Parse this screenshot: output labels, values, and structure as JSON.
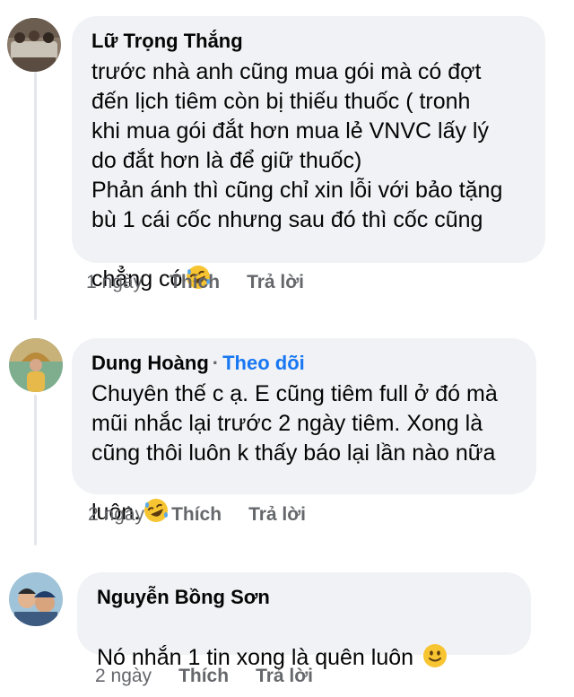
{
  "comments": [
    {
      "author": "Lữ Trọng Thắng",
      "follow": "",
      "text": "trước nhà anh cũng mua gói mà có đợt\nđến lịch tiêm còn bị thiếu thuốc ( tronh\nkhi mua gói đắt hơn mua lẻ VNVC lấy lý\ndo đắt hơn là để giữ thuốc)\nPhản ánh thì cũng chỉ xin lỗi với bảo tặng\nbù 1 cái cốc nhưng sau đó thì cốc cũng\nchẳng có",
      "emoji": "rofl-emoji",
      "time": "1 ngày",
      "like": "Thích",
      "reply": "Trả lời"
    },
    {
      "author": "Dung Hoàng",
      "dot": "·",
      "follow": "Theo dõi",
      "text": "Chuyên thế c ạ. E cũng tiêm full ở đó mà\nmũi nhắc lại trước 2 ngày tiêm. Xong là\ncũng thôi luôn k thấy báo lại lần nào nữa\nluôn.",
      "emoji": "rofl-emoji",
      "time": "2 ngày",
      "like": "Thích",
      "reply": "Trả lời"
    },
    {
      "author": "Nguyễn Bồng Sơn",
      "follow": "",
      "text": "Nó nhắn 1 tin xong là quên luôn",
      "emoji": "slight-smile-emoji",
      "time": "2 ngày",
      "like": "Thích",
      "reply": "Trả lời"
    }
  ],
  "colors": {
    "bubble": "#f0f2f5",
    "follow_link": "#1877f2",
    "meta_text": "#65676b",
    "emoji_face": "#f7c531"
  }
}
